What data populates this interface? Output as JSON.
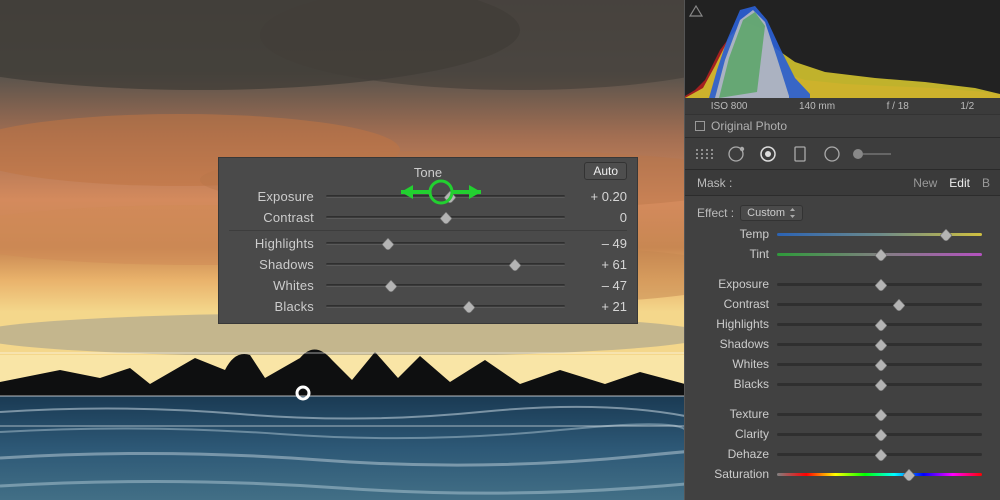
{
  "tone": {
    "title": "Tone",
    "auto_label": "Auto",
    "rows": [
      {
        "label": "Exposure",
        "value": "+ 0.20",
        "pos": 52
      },
      {
        "label": "Contrast",
        "value": "0",
        "pos": 50
      },
      {
        "label": "Highlights",
        "value": "– 49",
        "pos": 26
      },
      {
        "label": "Shadows",
        "value": "+ 61",
        "pos": 79
      },
      {
        "label": "Whites",
        "value": "– 47",
        "pos": 27
      },
      {
        "label": "Blacks",
        "value": "+ 21",
        "pos": 60
      }
    ]
  },
  "histogram": {
    "meta": [
      "ISO 800",
      "140 mm",
      "f / 18",
      "1/2"
    ]
  },
  "original_photo_label": "Original Photo",
  "mask": {
    "label": "Mask :",
    "tabs": [
      "New",
      "Edit",
      "B"
    ],
    "active": 1
  },
  "effect": {
    "label": "Effect :",
    "value": "Custom"
  },
  "side_sliders": [
    {
      "label": "Temp",
      "type": "temp",
      "pos": 82
    },
    {
      "label": "Tint",
      "type": "tint",
      "pos": 50
    },
    {
      "gap": true
    },
    {
      "label": "Exposure",
      "type": "plain",
      "pos": 50
    },
    {
      "label": "Contrast",
      "type": "plain",
      "pos": 59
    },
    {
      "label": "Highlights",
      "type": "plain",
      "pos": 50
    },
    {
      "label": "Shadows",
      "type": "plain",
      "pos": 50
    },
    {
      "label": "Whites",
      "type": "plain",
      "pos": 50
    },
    {
      "label": "Blacks",
      "type": "plain",
      "pos": 50
    },
    {
      "gap": true
    },
    {
      "label": "Texture",
      "type": "plain",
      "pos": 50
    },
    {
      "label": "Clarity",
      "type": "plain",
      "pos": 50
    },
    {
      "label": "Dehaze",
      "type": "plain",
      "pos": 50
    },
    {
      "label": "Saturation",
      "type": "sat",
      "pos": 64
    }
  ]
}
